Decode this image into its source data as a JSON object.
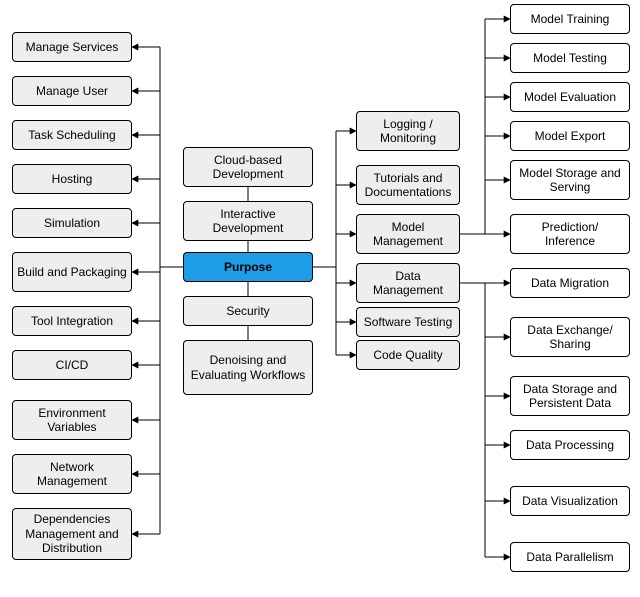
{
  "root": {
    "label": "Purpose"
  },
  "left": [
    "Manage Services",
    "Manage User",
    "Task Scheduling",
    "Hosting",
    "Simulation",
    "Build and Packaging",
    "Tool Integration",
    "CI/CD",
    "Environment Variables",
    "Network Management",
    "Dependencies Management and Distribution"
  ],
  "center": [
    "Cloud-based Development",
    "Interactive Development",
    "Security",
    "Denoising and Evaluating Workflows"
  ],
  "right": [
    "Logging / Monitoring",
    "Tutorials and Documentations",
    "Model Management",
    "Data Management",
    "Software Testing",
    "Code Quality"
  ],
  "model": [
    "Model Training",
    "Model Testing",
    "Model Evaluation",
    "Model Export",
    "Model Storage and Serving",
    "Prediction/ Inference"
  ],
  "datasub": [
    "Data Migration",
    "Data Exchange/ Sharing",
    "Data Storage and Persistent Data",
    "Data Processing",
    "Data Visualization",
    "Data Parallelism"
  ],
  "chart_data": {
    "type": "tree",
    "root": "Purpose",
    "children": {
      "direct_left_list": [
        "Manage Services",
        "Manage User",
        "Task Scheduling",
        "Hosting",
        "Simulation",
        "Build and Packaging",
        "Tool Integration",
        "CI/CD",
        "Environment Variables",
        "Network Management",
        "Dependencies Management and Distribution"
      ],
      "adjacent_categories": [
        "Cloud-based Development",
        "Interactive Development",
        "Security",
        "Denoising and Evaluating Workflows"
      ],
      "right_branches": [
        {
          "name": "Logging / Monitoring"
        },
        {
          "name": "Tutorials and Documentations"
        },
        {
          "name": "Model Management",
          "children": [
            "Model Training",
            "Model Testing",
            "Model Evaluation",
            "Model Export",
            "Model Storage and Serving",
            "Prediction/ Inference"
          ]
        },
        {
          "name": "Data Management",
          "children": [
            "Data Migration",
            "Data Exchange/ Sharing",
            "Data Storage and Persistent Data",
            "Data Processing",
            "Data Visualization",
            "Data Parallelism"
          ]
        },
        {
          "name": "Software Testing"
        },
        {
          "name": "Code Quality"
        }
      ]
    }
  }
}
